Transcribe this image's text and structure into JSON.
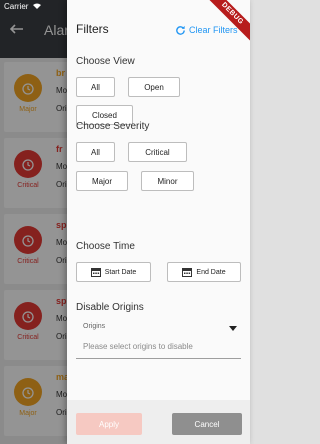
{
  "status_bar": {
    "carrier": "Carrier"
  },
  "appbar": {
    "title": "Alarms"
  },
  "alarm_list": [
    {
      "name": "br",
      "line1": "Mo",
      "line2": "Ori",
      "severity": "Major",
      "color": "#f5a623"
    },
    {
      "name": "fr",
      "line1": "Mo",
      "line2": "Ori",
      "severity": "Critical",
      "color": "#e53935"
    },
    {
      "name": "sp",
      "line1": "Mo",
      "line2": "Ori",
      "severity": "Critical",
      "color": "#e53935"
    },
    {
      "name": "sp",
      "line1": "Mo",
      "line2": "Ori",
      "severity": "Critical",
      "color": "#e53935"
    },
    {
      "name": "ma",
      "line1": "Mo",
      "line2": "Ori",
      "severity": "Major",
      "color": "#f5a623"
    }
  ],
  "drawer": {
    "title": "Filters",
    "clear_label": "Clear Filters",
    "debug_banner": "DEBUG",
    "view": {
      "heading": "Choose View",
      "options": [
        "All",
        "Open",
        "Closed"
      ]
    },
    "severity": {
      "heading": "Choose Severity",
      "options": [
        "All",
        "Critical",
        "Major",
        "Minor"
      ]
    },
    "time": {
      "heading": "Choose Time",
      "start": "Start Date",
      "end": "End Date"
    },
    "origins": {
      "heading": "Disable Origins",
      "label": "Origins",
      "placeholder": "Please select origins to disable"
    },
    "apply": "Apply",
    "cancel": "Cancel"
  },
  "colors": {
    "accent": "#2196f3",
    "apply_disabled": "#f6c9c2",
    "cancel": "#8f8f8f",
    "major": "#f5a623",
    "critical": "#e53935"
  },
  "icons": {
    "back": "arrow-left-icon",
    "refresh": "refresh-icon",
    "calendar": "calendar-icon",
    "alarm": "alarm-clock-icon",
    "dropdown": "caret-down-icon"
  }
}
